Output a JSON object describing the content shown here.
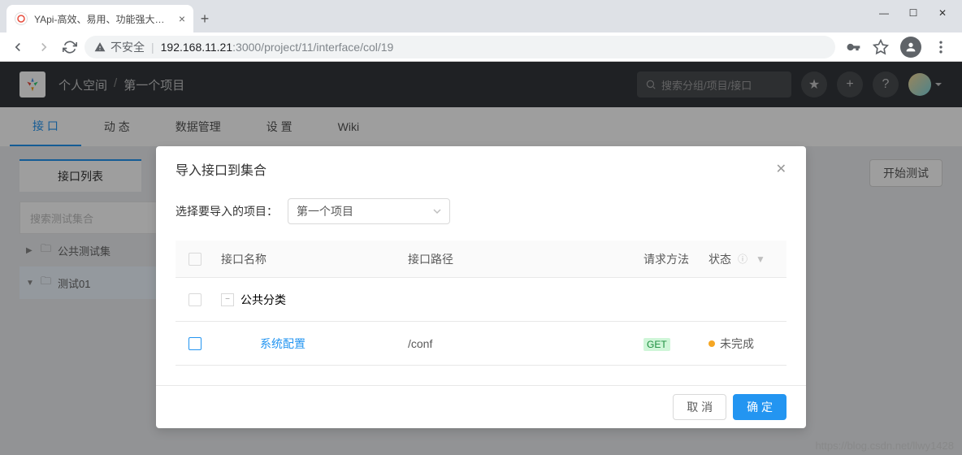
{
  "browser": {
    "tab_title": "YApi-高效、易用、功能强大的可…",
    "insecure_label": "不安全",
    "url_host": "192.168.11.21",
    "url_port_path": ":3000/project/11/interface/col/19"
  },
  "header": {
    "breadcrumb": [
      "个人空间",
      "第一个项目"
    ],
    "search_placeholder": "搜索分组/项目/接口"
  },
  "nav_tabs": [
    "接 口",
    "动 态",
    "数据管理",
    "设 置",
    "Wiki"
  ],
  "sidebar": {
    "tab_label": "接口列表",
    "search_placeholder": "搜索测试集合",
    "items": [
      {
        "label": "公共测试集",
        "active": false
      },
      {
        "label": "测试01",
        "active": true
      }
    ]
  },
  "main": {
    "start_test": "开始测试"
  },
  "modal": {
    "title": "导入接口到集合",
    "project_label": "选择要导入的项目：",
    "project_value": "第一个项目",
    "columns": {
      "name": "接口名称",
      "path": "接口路径",
      "method": "请求方法",
      "status": "状态"
    },
    "group_row": {
      "name": "公共分类"
    },
    "data_row": {
      "name": "系统配置",
      "path": "/conf",
      "method": "GET",
      "status": "未完成"
    },
    "cancel": "取 消",
    "confirm": "确 定"
  },
  "watermark": "https://blog.csdn.net/llwy1428"
}
